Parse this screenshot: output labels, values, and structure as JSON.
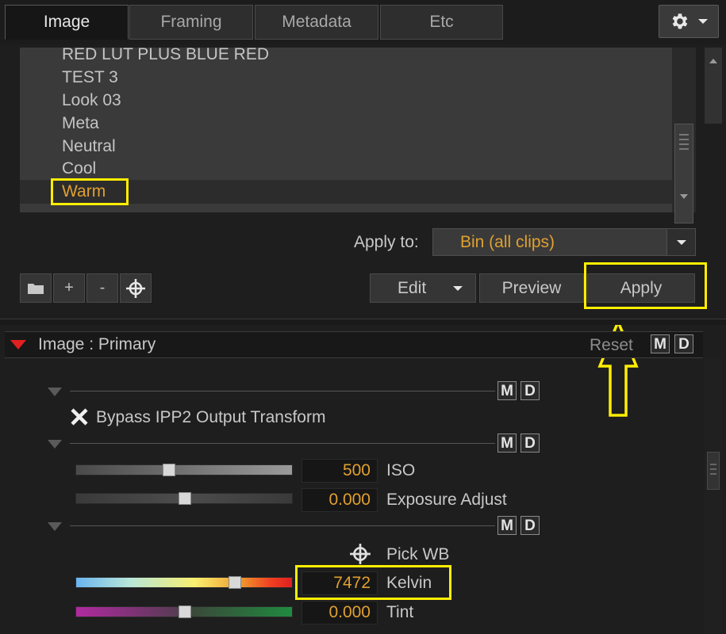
{
  "tabs": [
    {
      "label": "Image",
      "active": true
    },
    {
      "label": "Framing",
      "active": false
    },
    {
      "label": "Metadata",
      "active": false
    },
    {
      "label": "Etc",
      "active": false
    }
  ],
  "settings_icon": "gear-icon",
  "looks": {
    "items": [
      "RED LUT PLUS BLUE RED",
      "TEST 3",
      "Look 03",
      "Meta",
      "Neutral",
      "Cool",
      "Warm"
    ],
    "selected": "Warm"
  },
  "apply_to": {
    "label": "Apply to:",
    "value": "Bin (all clips)"
  },
  "tools": {
    "folder_icon": "folder-icon",
    "add": "+",
    "remove": "-",
    "target_icon": "crosshair-icon"
  },
  "buttons": {
    "edit": "Edit",
    "preview": "Preview",
    "apply": "Apply"
  },
  "section": {
    "title": "Image : Primary",
    "reset": "Reset",
    "m": "M",
    "d": "D"
  },
  "controls": {
    "bypass_label": "Bypass IPP2 Output Transform",
    "bypass_checked": true,
    "iso": {
      "label": "ISO",
      "value": "500",
      "fraction": 0.43
    },
    "exposure": {
      "label": "Exposure Adjust",
      "value": "0.000",
      "fraction": 0.5
    },
    "pick_wb": "Pick WB",
    "kelvin": {
      "label": "Kelvin",
      "value": "7472",
      "fraction": 0.73
    },
    "tint": {
      "label": "Tint",
      "value": "0.000",
      "fraction": 0.5
    }
  },
  "colors": {
    "accent_orange": "#e0a030",
    "highlight_yellow": "#ffee00",
    "collapse_red": "#e02020"
  }
}
